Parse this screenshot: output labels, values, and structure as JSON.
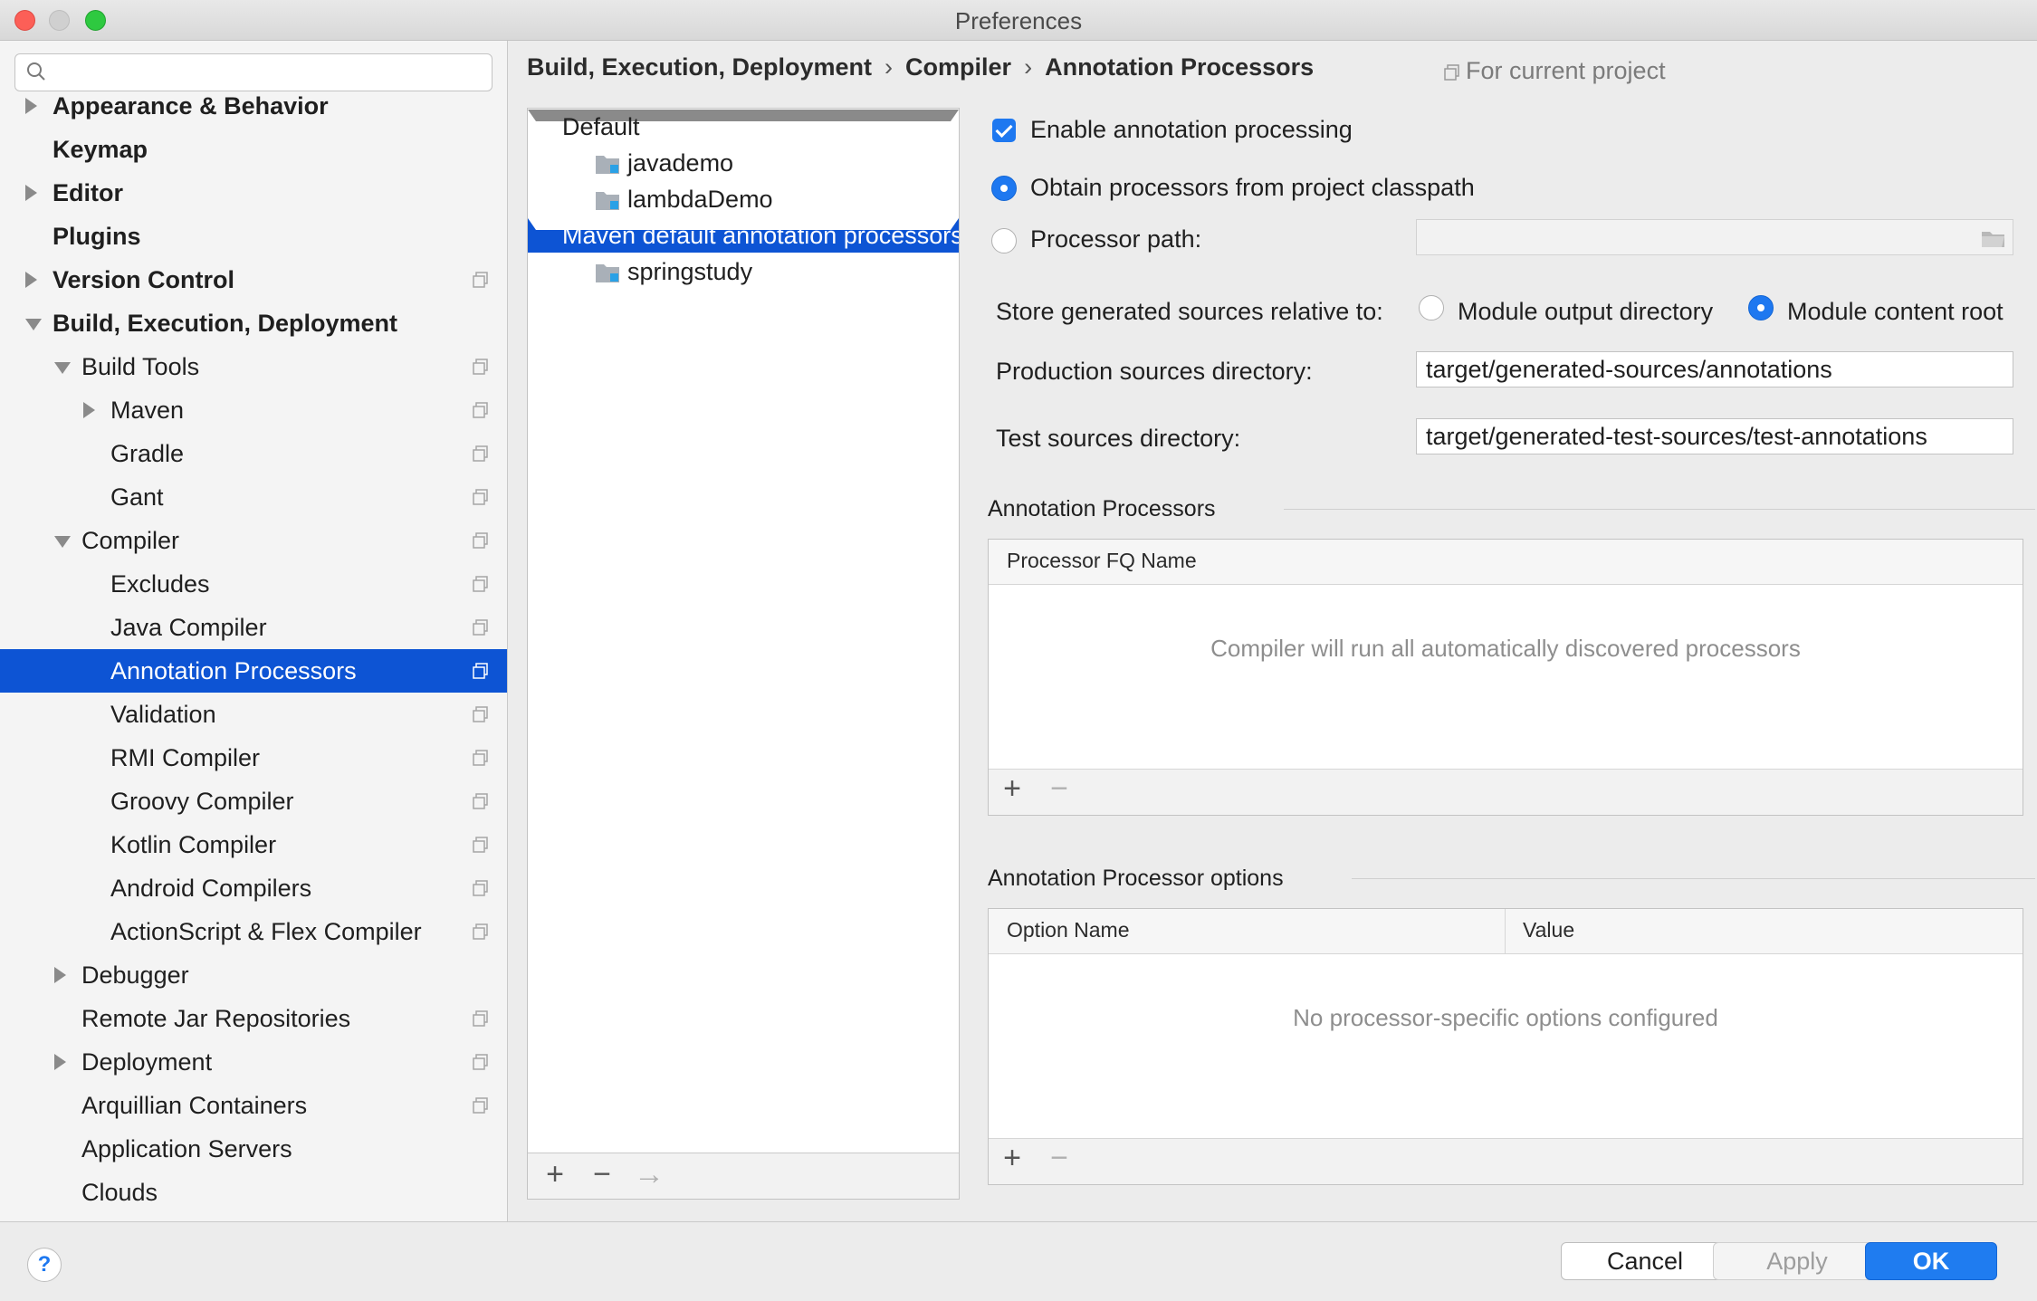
{
  "window": {
    "title": "Preferences"
  },
  "search": {
    "placeholder": "",
    "value": ""
  },
  "sidebar": {
    "items": [
      {
        "label": "Appearance & Behavior",
        "level": 0,
        "bold": true,
        "arrow": "right",
        "proj": false
      },
      {
        "label": "Keymap",
        "level": 0,
        "bold": true,
        "arrow": "none",
        "proj": false
      },
      {
        "label": "Editor",
        "level": 0,
        "bold": true,
        "arrow": "right",
        "proj": false
      },
      {
        "label": "Plugins",
        "level": 0,
        "bold": true,
        "arrow": "none",
        "proj": false
      },
      {
        "label": "Version Control",
        "level": 0,
        "bold": true,
        "arrow": "right",
        "proj": true
      },
      {
        "label": "Build, Execution, Deployment",
        "level": 0,
        "bold": true,
        "arrow": "down",
        "proj": false
      },
      {
        "label": "Build Tools",
        "level": 1,
        "bold": false,
        "arrow": "down",
        "proj": true
      },
      {
        "label": "Maven",
        "level": 2,
        "bold": false,
        "arrow": "right",
        "proj": true
      },
      {
        "label": "Gradle",
        "level": 2,
        "bold": false,
        "arrow": "none",
        "proj": true
      },
      {
        "label": "Gant",
        "level": 2,
        "bold": false,
        "arrow": "none",
        "proj": true
      },
      {
        "label": "Compiler",
        "level": 1,
        "bold": false,
        "arrow": "down",
        "proj": true
      },
      {
        "label": "Excludes",
        "level": 2,
        "bold": false,
        "arrow": "none",
        "proj": true
      },
      {
        "label": "Java Compiler",
        "level": 2,
        "bold": false,
        "arrow": "none",
        "proj": true
      },
      {
        "label": "Annotation Processors",
        "level": 2,
        "bold": false,
        "arrow": "none",
        "proj": true,
        "selected": true
      },
      {
        "label": "Validation",
        "level": 2,
        "bold": false,
        "arrow": "none",
        "proj": true
      },
      {
        "label": "RMI Compiler",
        "level": 2,
        "bold": false,
        "arrow": "none",
        "proj": true
      },
      {
        "label": "Groovy Compiler",
        "level": 2,
        "bold": false,
        "arrow": "none",
        "proj": true
      },
      {
        "label": "Kotlin Compiler",
        "level": 2,
        "bold": false,
        "arrow": "none",
        "proj": true
      },
      {
        "label": "Android Compilers",
        "level": 2,
        "bold": false,
        "arrow": "none",
        "proj": true
      },
      {
        "label": "ActionScript & Flex Compiler",
        "level": 2,
        "bold": false,
        "arrow": "none",
        "proj": true
      },
      {
        "label": "Debugger",
        "level": 1,
        "bold": false,
        "arrow": "right",
        "proj": false
      },
      {
        "label": "Remote Jar Repositories",
        "level": 1,
        "bold": false,
        "arrow": "none",
        "proj": true
      },
      {
        "label": "Deployment",
        "level": 1,
        "bold": false,
        "arrow": "right",
        "proj": true
      },
      {
        "label": "Arquillian Containers",
        "level": 1,
        "bold": false,
        "arrow": "none",
        "proj": true
      },
      {
        "label": "Application Servers",
        "level": 1,
        "bold": false,
        "arrow": "none",
        "proj": false
      },
      {
        "label": "Clouds",
        "level": 1,
        "bold": false,
        "arrow": "none",
        "proj": false
      }
    ]
  },
  "breadcrumb": {
    "parts": [
      "Build, Execution, Deployment",
      "Compiler",
      "Annotation Processors"
    ],
    "separator": "›",
    "scope": "For current project"
  },
  "profiles": {
    "items": [
      {
        "label": "Default",
        "kind": "group",
        "selected": false
      },
      {
        "label": "javademo",
        "kind": "module",
        "selected": false
      },
      {
        "label": "lambdaDemo",
        "kind": "module",
        "selected": false
      },
      {
        "label": "Maven default annotation processors profile",
        "kind": "group",
        "selected": true
      },
      {
        "label": "springstudy",
        "kind": "module",
        "selected": false
      }
    ],
    "toolbar": {
      "add": "+",
      "remove": "−",
      "move": "→"
    }
  },
  "settings": {
    "enable_label": "Enable annotation processing",
    "enable_checked": true,
    "obtain_label": "Obtain processors from project classpath",
    "processor_path_label": "Processor path:",
    "processor_path_value": "",
    "store_label": "Store generated sources relative to:",
    "module_output_label": "Module output directory",
    "module_content_label": "Module content root",
    "production_label": "Production sources directory:",
    "production_value": "target/generated-sources/annotations",
    "test_label": "Test sources directory:",
    "test_value": "target/generated-test-sources/test-annotations"
  },
  "annotation_processors": {
    "title": "Annotation Processors",
    "column": "Processor FQ Name",
    "empty": "Compiler will run all automatically discovered processors",
    "add": "+",
    "remove": "−"
  },
  "processor_options": {
    "title": "Annotation Processor options",
    "columns": [
      "Option Name",
      "Value"
    ],
    "empty": "No processor-specific options configured",
    "add": "+",
    "remove": "−"
  },
  "footer": {
    "help": "?",
    "cancel": "Cancel",
    "apply": "Apply",
    "ok": "OK"
  },
  "colors": {
    "selection": "#0d54d4",
    "accent": "#1f7cf0"
  }
}
